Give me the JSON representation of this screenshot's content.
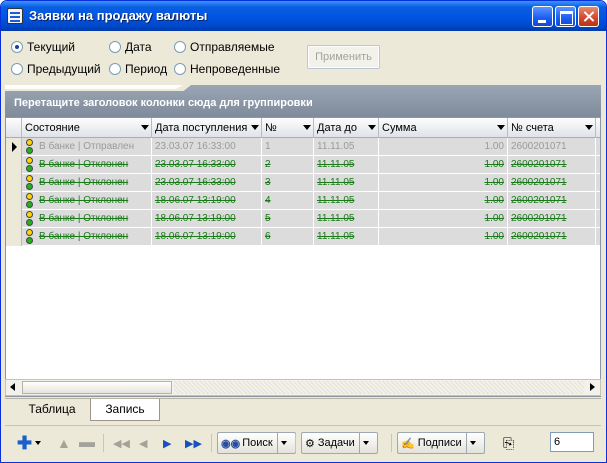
{
  "window": {
    "title": "Заявки на продажу валюты"
  },
  "filters": {
    "radios": [
      {
        "label": "Текущий",
        "checked": true
      },
      {
        "label": "Дата",
        "checked": false
      },
      {
        "label": "Отправляемые",
        "checked": false
      },
      {
        "label": "Предыдущий",
        "checked": false
      },
      {
        "label": "Период",
        "checked": false
      },
      {
        "label": "Непроведенные",
        "checked": false
      }
    ],
    "apply_label": "Применить"
  },
  "grouping": {
    "hint": "Перетащите заголовок колонки сюда для группировки"
  },
  "grid": {
    "columns": [
      "Состояние",
      "Дата поступления",
      "№",
      "Дата до",
      "Сумма",
      "№ счета"
    ],
    "rows": [
      {
        "status": "В банке | Отправлен",
        "received": "23.03.07 16:33:00",
        "num": "1",
        "date_to": "11.11.05",
        "amount": "1.00",
        "account": "2600201071"
      },
      {
        "status": "В банке | Отклонен",
        "received": "23.03.07 16:33:00",
        "num": "2",
        "date_to": "11.11.05",
        "amount": "1.00",
        "account": "2600201071"
      },
      {
        "status": "В банке | Отклонен",
        "received": "23.03.07 16:33:00",
        "num": "3",
        "date_to": "11.11.05",
        "amount": "1.00",
        "account": "2600201071"
      },
      {
        "status": "В банке | Отклонен",
        "received": "18.06.07 13:19:00",
        "num": "4",
        "date_to": "11.11.05",
        "amount": "1.00",
        "account": "2600201071"
      },
      {
        "status": "В банке | Отклонен",
        "received": "18.06.07 13:19:00",
        "num": "5",
        "date_to": "11.11.05",
        "amount": "1.00",
        "account": "2600201071"
      },
      {
        "status": "В банке | Отклонен",
        "received": "18.06.07 13:19:00",
        "num": "6",
        "date_to": "11.11.05",
        "amount": "1.00",
        "account": "2600201071"
      }
    ]
  },
  "tabs": [
    {
      "label": "Таблица",
      "active": false
    },
    {
      "label": "Запись",
      "active": true
    }
  ],
  "toolbar": {
    "search_label": "Поиск",
    "tasks_label": "Задачи",
    "signatures_label": "Подписи",
    "record_count": "6"
  },
  "colors": {
    "title_bar": "#0054e3",
    "rejected_text": "#1a7a1a",
    "sent_text": "#9a9a9a"
  }
}
